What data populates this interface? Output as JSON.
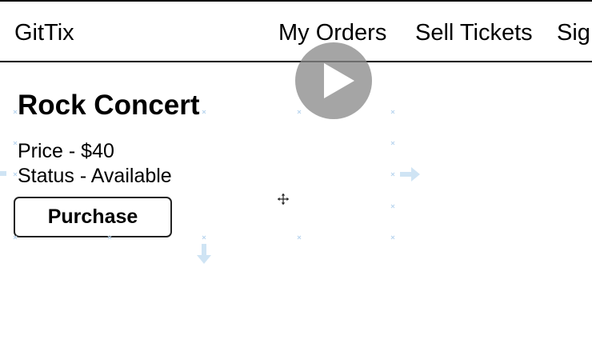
{
  "navbar": {
    "brand": "GitTix",
    "links": [
      {
        "label": "My Orders"
      },
      {
        "label": "Sell Tickets"
      },
      {
        "label": "Sig"
      }
    ]
  },
  "ticket": {
    "title": "Rock Concert",
    "price_text": "Price - $40",
    "status_text": "Status - Available",
    "purchase_label": "Purchase"
  },
  "overlay": {
    "play_icon": "play-icon",
    "move_cursor_icon": "move-cursor-icon",
    "guide_color": "#cfe4f4"
  },
  "colors": {
    "text": "#000000",
    "border": "#222222",
    "overlay": "#8c8c8c"
  }
}
